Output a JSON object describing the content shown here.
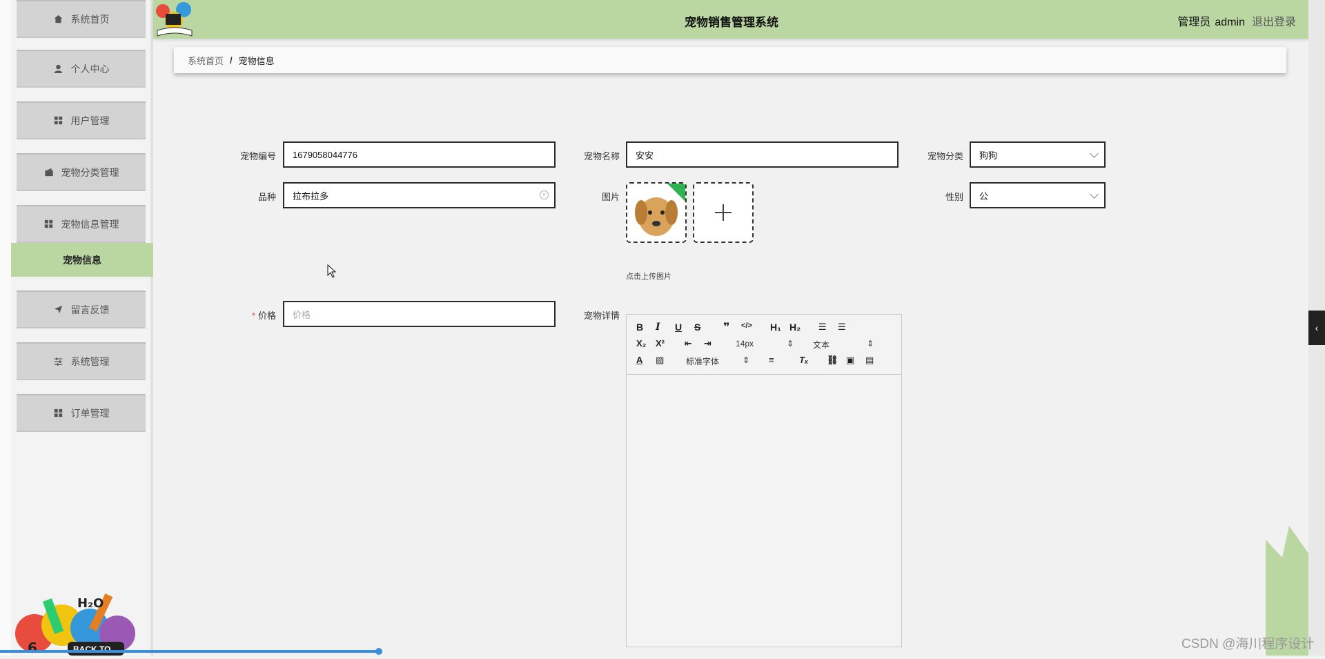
{
  "app": {
    "title": "宠物销售管理系统"
  },
  "header": {
    "role": "管理员",
    "username": "admin",
    "logout": "退出登录"
  },
  "sidebar": {
    "items": [
      {
        "label": "系统首页",
        "icon": "home-icon"
      },
      {
        "label": "个人中心",
        "icon": "user-icon"
      },
      {
        "label": "用户管理",
        "icon": "grid-icon"
      },
      {
        "label": "宠物分类管理",
        "icon": "wallet-icon"
      },
      {
        "label": "宠物信息管理",
        "icon": "grid-icon"
      },
      {
        "label": "留言反馈",
        "icon": "send-icon"
      },
      {
        "label": "系统管理",
        "icon": "sliders-icon"
      },
      {
        "label": "订单管理",
        "icon": "grid-icon"
      }
    ],
    "active_sub": "宠物信息"
  },
  "breadcrumb": {
    "home": "系统首页",
    "sep": "/",
    "current": "宠物信息"
  },
  "form": {
    "pet_id": {
      "label": "宠物编号",
      "value": "1679058044776"
    },
    "pet_name": {
      "label": "宠物名称",
      "value": "安安"
    },
    "category": {
      "label": "宠物分类",
      "value": "狗狗"
    },
    "breed": {
      "label": "品种",
      "value": "拉布拉多"
    },
    "image": {
      "label": "图片",
      "hint": "点击上传图片"
    },
    "gender": {
      "label": "性别",
      "value": "公"
    },
    "price": {
      "required_mark": "*",
      "label": "价格",
      "placeholder": "价格"
    },
    "details": {
      "label": "宠物详情"
    }
  },
  "editor": {
    "font_size": "14px",
    "text_type": "文本",
    "font_family": "标准字体"
  },
  "deco": {
    "back_to": "BACK TO"
  },
  "watermark": "CSDN @海川程序设计",
  "colors": {
    "accent": "#bad7a2",
    "sidebar_item": "#d3d3d3",
    "border": "#2b2b2b",
    "required": "#e74c3c"
  }
}
